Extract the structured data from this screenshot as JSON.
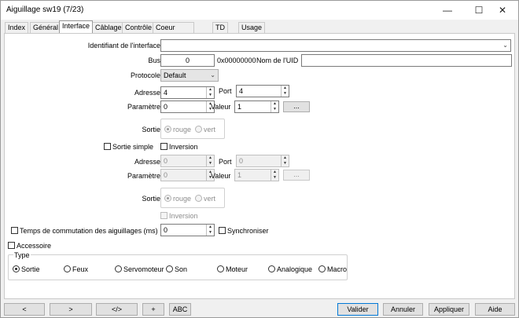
{
  "window": {
    "title": "Aiguillage sw19 (7/23)",
    "minimize": "—",
    "maximize": "☐",
    "close": "✕"
  },
  "tabs": [
    "Index",
    "Général",
    "Interface",
    "Câblage",
    "Contrôle",
    "Coeur d'aiguillage",
    "TD",
    "Usage"
  ],
  "active_tab": "Interface",
  "interface": {
    "id_label": "Identifiant de l'interface",
    "id_value": "",
    "bus_label": "Bus",
    "bus_value": "0",
    "bus_hex": "0x00000000",
    "uid_label": "Nom de l'UID",
    "uid_value": "",
    "protocol_label": "Protocole",
    "protocol_value": "Default",
    "address_label": "Adresse",
    "address_value": "4",
    "port_label": "Port",
    "port_value": "4",
    "param_label": "Paramètre",
    "param_value": "0",
    "valeur_label": "Valeur",
    "valeur_value": "1",
    "dots_label": "...",
    "sortie_label": "Sortie",
    "rouge": "rouge",
    "vert": "vert"
  },
  "second": {
    "sortie_simple": "Sortie simple",
    "inversion": "Inversion",
    "address_label": "Adresse",
    "address_value": "0",
    "port_label": "Port",
    "port_value": "0",
    "param_label": "Paramètre",
    "param_value": "0",
    "valeur_label": "Valeur",
    "valeur_value": "1",
    "dots_label": "...",
    "sortie_label": "Sortie",
    "rouge": "rouge",
    "vert": "vert",
    "inversion2": "Inversion"
  },
  "commutation": {
    "label": "Temps de commutation des aiguillages (ms)",
    "value": "0",
    "sync": "Synchroniser"
  },
  "accessoire": "Accessoire",
  "type": {
    "label": "Type",
    "options": [
      "Sortie",
      "Feux",
      "Servomoteur",
      "Son",
      "Moteur",
      "Analogique",
      "Macro"
    ],
    "selected": "Sortie"
  },
  "bottom": {
    "prev": "<",
    "next": ">",
    "code": "</>",
    "plus": "+",
    "abc": "ABC",
    "valider": "Valider",
    "annuler": "Annuler",
    "appliquer": "Appliquer",
    "aide": "Aide"
  }
}
